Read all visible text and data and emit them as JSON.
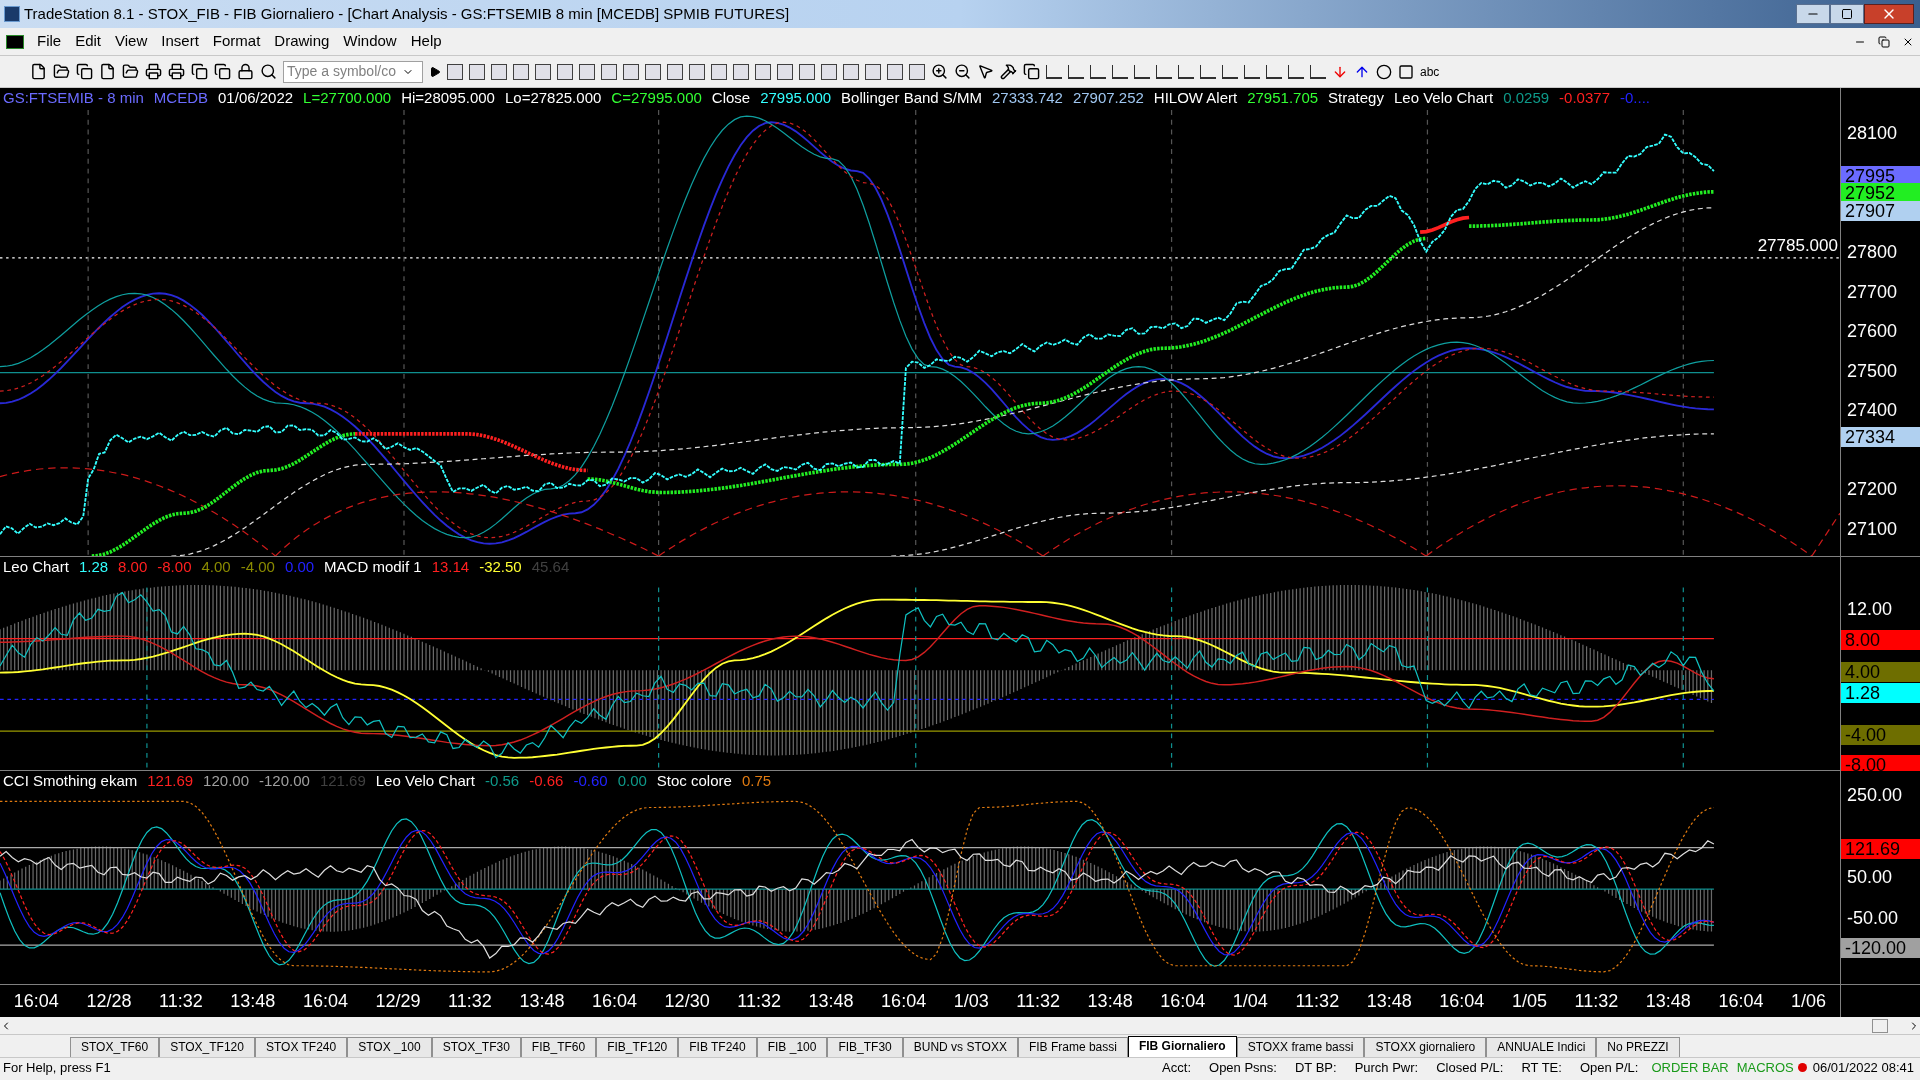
{
  "window": {
    "title": "TradeStation 8.1 - STOX_FIB - FIB Giornaliero - [Chart Analysis - GS:FTSEMIB  8 min  [MCEDB] SPMIB FUTURES]"
  },
  "menu": [
    "File",
    "Edit",
    "View",
    "Insert",
    "Format",
    "Drawing",
    "Window",
    "Help"
  ],
  "toolbar": {
    "symbol_field": {
      "placeholder": "Type a symbol/co"
    },
    "text_tool": "abc"
  },
  "panes": [
    {
      "kind": "price",
      "legend": [
        {
          "text": "GS:FTSEMIB - 8 min",
          "color": "#6b6bff"
        },
        {
          "text": "MCEDB",
          "color": "#6b6bff"
        },
        {
          "text": "01/06/2022",
          "color": "#ffffff"
        },
        {
          "text": "L=27700.000",
          "color": "#33ff33"
        },
        {
          "text": "Hi=28095.000",
          "color": "#ffffff"
        },
        {
          "text": "Lo=27825.000",
          "color": "#ffffff"
        },
        {
          "text": "C=27995.000",
          "color": "#33ff33"
        },
        {
          "text": "Close",
          "color": "#ffffff"
        },
        {
          "text": "27995.000",
          "color": "#33ffff"
        },
        {
          "text": "Bollinger Band S/MM",
          "color": "#ffffff"
        },
        {
          "text": "27333.742",
          "color": "#9fc6f0"
        },
        {
          "text": "27907.252",
          "color": "#9fc6f0"
        },
        {
          "text": "HILOW Alert",
          "color": "#ffffff"
        },
        {
          "text": "27951.705",
          "color": "#33ff33"
        },
        {
          "text": "Strategy",
          "color": "#ffffff"
        },
        {
          "text": "Leo Velo Chart",
          "color": "#ffffff"
        },
        {
          "text": "0.0259",
          "color": "#0e9a8a"
        },
        {
          "text": "-0.0377",
          "color": "#ff2020"
        },
        {
          "text": "-0....",
          "color": "#2222ff"
        }
      ],
      "marker": "27785.000",
      "ticks": [
        "28100",
        "27800",
        "27700",
        "27600",
        "27500",
        "27400",
        "27200",
        "27100"
      ],
      "badges": [
        {
          "text": "27995",
          "color": "#6b6bff"
        },
        {
          "text": "27952",
          "color": "#22ee22"
        },
        {
          "text": "27907",
          "color": "#b0d0f0"
        },
        {
          "text": "27334",
          "color": "#b0d0f0"
        }
      ]
    },
    {
      "kind": "macd",
      "legend": [
        {
          "text": "Leo Chart",
          "color": "#ffffff"
        },
        {
          "text": "1.28",
          "color": "#33ffff"
        },
        {
          "text": "8.00",
          "color": "#ff2020"
        },
        {
          "text": "-8.00",
          "color": "#ff2020"
        },
        {
          "text": "4.00",
          "color": "#8a8a00"
        },
        {
          "text": "-4.00",
          "color": "#8a8a00"
        },
        {
          "text": "0.00",
          "color": "#2222ff"
        },
        {
          "text": "MACD modif 1",
          "color": "#ffffff"
        },
        {
          "text": "13.14",
          "color": "#ff2020"
        },
        {
          "text": "-32.50",
          "color": "#ffff33"
        },
        {
          "text": "45.64",
          "color": "#404040"
        }
      ],
      "ticks": [
        "12.00"
      ],
      "badges": [
        {
          "text": "8.00",
          "color": "#ff0000"
        },
        {
          "text": "4.00",
          "color": "#6e6e00"
        },
        {
          "text": "1.28",
          "color": "#00ffff"
        },
        {
          "text": "-4.00",
          "color": "#6e6e00"
        },
        {
          "text": "-8.00",
          "color": "#ff0000"
        }
      ]
    },
    {
      "kind": "cci",
      "legend": [
        {
          "text": "CCI Smothing ekam",
          "color": "#ffffff"
        },
        {
          "text": "121.69",
          "color": "#ff2020"
        },
        {
          "text": "120.00",
          "color": "#a0a0a0"
        },
        {
          "text": "-120.00",
          "color": "#a0a0a0"
        },
        {
          "text": "121.69",
          "color": "#404040"
        },
        {
          "text": "Leo Velo Chart",
          "color": "#ffffff"
        },
        {
          "text": "-0.56",
          "color": "#0e9a8a"
        },
        {
          "text": "-0.66",
          "color": "#ff2020"
        },
        {
          "text": "-0.60",
          "color": "#2222ff"
        },
        {
          "text": "0.00",
          "color": "#0e9a8a"
        },
        {
          "text": "Stoc colore",
          "color": "#ffffff"
        },
        {
          "text": "0.75",
          "color": "#e07a10"
        }
      ],
      "ticks": [
        "250.00",
        "50.00",
        "-50.00"
      ],
      "badges": [
        {
          "text": "121.69",
          "color": "#ff0000"
        },
        {
          "text": "-120.00",
          "color": "#a0a0a0"
        }
      ]
    }
  ],
  "time_axis": [
    "16:04",
    "12/28",
    "11:32",
    "13:48",
    "16:04",
    "12/29",
    "11:32",
    "13:48",
    "16:04",
    "12/30",
    "11:32",
    "13:48",
    "16:04",
    "1/03",
    "11:32",
    "13:48",
    "16:04",
    "1/04",
    "11:32",
    "13:48",
    "16:04",
    "1/05",
    "11:32",
    "13:48",
    "16:04",
    "1/06"
  ],
  "tabs": [
    {
      "label": "STOX_TF60",
      "selected": false
    },
    {
      "label": "STOX_TF120",
      "selected": false
    },
    {
      "label": "STOX TF240",
      "selected": false
    },
    {
      "label": "STOX _100",
      "selected": false
    },
    {
      "label": "STOX_TF30",
      "selected": false
    },
    {
      "label": "FIB_TF60",
      "selected": false
    },
    {
      "label": "FIB_TF120",
      "selected": false
    },
    {
      "label": "FIB TF240",
      "selected": false
    },
    {
      "label": "FIB _100",
      "selected": false
    },
    {
      "label": "FIB_TF30",
      "selected": false
    },
    {
      "label": "BUND vs STOXX",
      "selected": false
    },
    {
      "label": "FIB Frame bassi",
      "selected": false
    },
    {
      "label": "FIB Giornaliero",
      "selected": true
    },
    {
      "label": "STOXX frame bassi",
      "selected": false
    },
    {
      "label": "STOXX giornaliero",
      "selected": false
    },
    {
      "label": "ANNUALE Indici",
      "selected": false
    },
    {
      "label": "No PREZZI",
      "selected": false
    }
  ],
  "status_bar": {
    "help": "For Help, press F1",
    "fields": [
      "Acct:",
      "Open Psns:",
      "DT BP:",
      "Purch Pwr:",
      "Closed P/L:",
      "RT TE:",
      "Open P/L:"
    ],
    "order_bar": "ORDER BAR",
    "macros": "MACROS",
    "datetime": "06/01/2022 08:41"
  }
}
